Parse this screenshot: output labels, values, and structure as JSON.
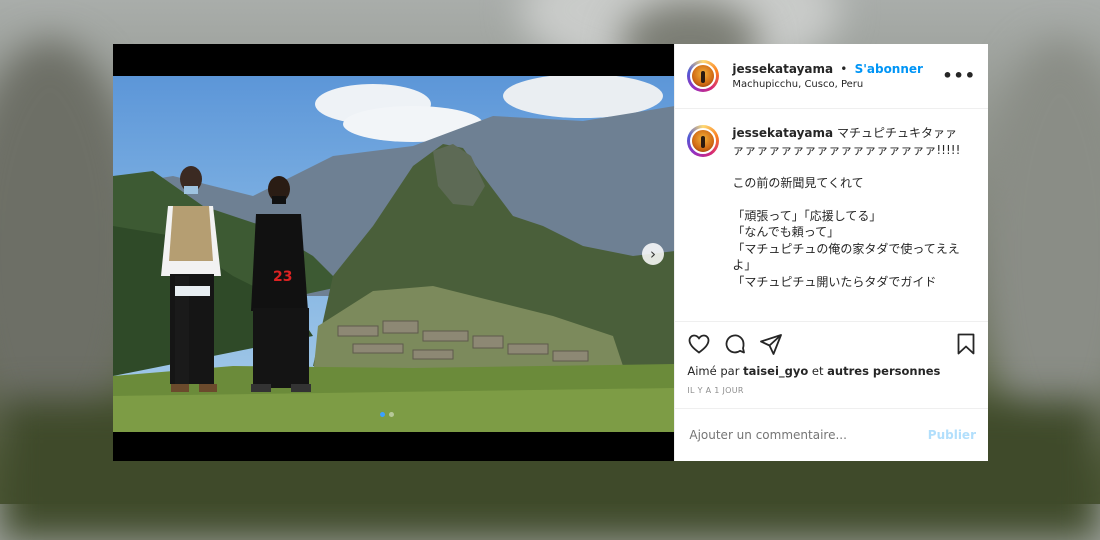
{
  "post": {
    "username": "jessekatayama",
    "bullet": "•",
    "follow_label": "S'abonner",
    "location": "Machupicchu, Cusco, Peru",
    "more_label": "•••",
    "next_label": "›",
    "caption": {
      "username": "jessekatayama",
      "text": "マチュピチュキタァァァァァァァァァァァァァァァァァァァ!!!!!\n\nこの前の新聞見てくれて\n\n「頑張って」「応援してる」\n「なんでも頼って」\n「マチュピチュの俺の家タダで使ってええよ」\n「マチュピチュ開いたらタダでガイド"
    },
    "likes": {
      "prefix": "Aimé par",
      "user": "taisei_gyo",
      "joiner": "et",
      "others": "autres personnes"
    },
    "timestamp": "IL Y A 1 JOUR",
    "comment_placeholder": "Ajouter un commentaire...",
    "publish_label": "Publier",
    "carousel": {
      "count": 2,
      "active": 0
    }
  },
  "colors": {
    "accent": "#0095f6",
    "text": "#262626",
    "muted": "#8e8e8e"
  },
  "icons": [
    "heart-icon",
    "comment-icon",
    "share-icon",
    "bookmark-icon",
    "more-icon",
    "chevron-right-icon"
  ]
}
